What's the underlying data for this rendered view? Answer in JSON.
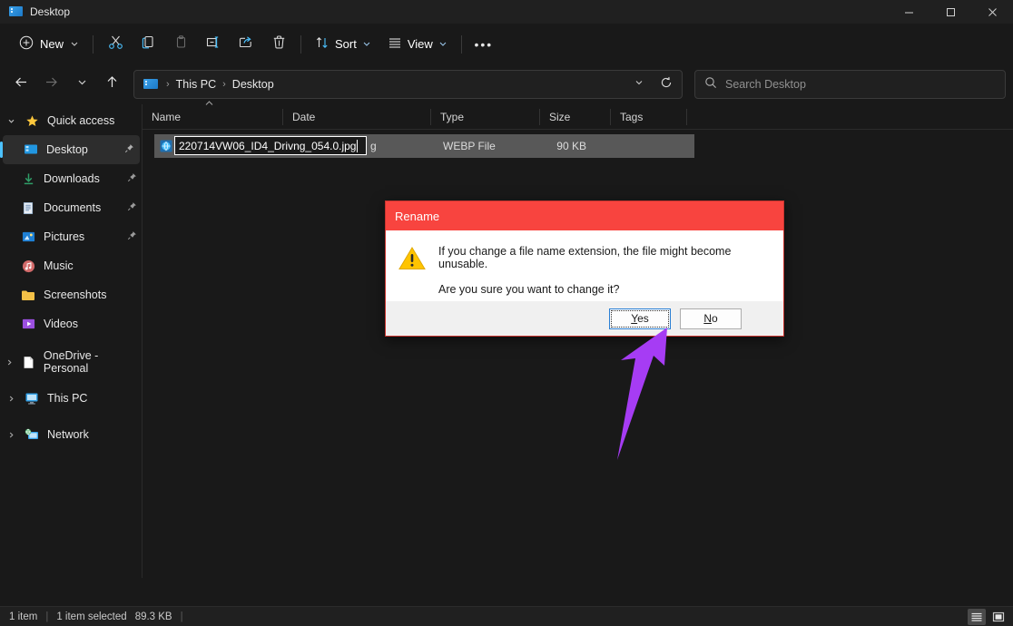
{
  "window": {
    "title": "Desktop",
    "icon": "desktop-folder-icon",
    "controls": {
      "minimize": "minimize-icon",
      "maximize": "maximize-icon",
      "close": "close-icon"
    }
  },
  "toolbar": {
    "new_label": "New",
    "new_icon": "plus-circle-icon",
    "cut_icon": "scissors-icon",
    "copy_icon": "copy-icon",
    "paste_icon": "paste-icon",
    "rename_icon": "rename-icon",
    "share_icon": "share-icon",
    "delete_icon": "trash-icon",
    "sort_label": "Sort",
    "sort_icon": "sort-arrows-icon",
    "view_label": "View",
    "view_icon": "list-lines-icon",
    "more_label": "•••"
  },
  "nav": {
    "back_icon": "arrow-left-icon",
    "forward_icon": "arrow-right-icon",
    "recent_icon": "chevron-down-icon",
    "up_icon": "arrow-up-icon",
    "breadcrumb": [
      "This PC",
      "Desktop"
    ],
    "breadcrumb_separator": "›",
    "dropdown_icon": "chevron-down-icon",
    "refresh_icon": "refresh-icon"
  },
  "search": {
    "placeholder": "Search Desktop",
    "value": "",
    "icon": "search-icon"
  },
  "sidebar": {
    "groups": [
      {
        "label": "Quick access",
        "icon": "star-icon",
        "expanded": true,
        "items": [
          {
            "label": "Desktop",
            "icon": "desktop-icon",
            "pinned": true,
            "selected": true
          },
          {
            "label": "Downloads",
            "icon": "download-icon",
            "pinned": true,
            "selected": false
          },
          {
            "label": "Documents",
            "icon": "document-icon",
            "pinned": true,
            "selected": false
          },
          {
            "label": "Pictures",
            "icon": "pictures-icon",
            "pinned": true,
            "selected": false
          },
          {
            "label": "Music",
            "icon": "music-icon",
            "pinned": false,
            "selected": false
          },
          {
            "label": "Screenshots",
            "icon": "folder-icon",
            "pinned": false,
            "selected": false
          },
          {
            "label": "Videos",
            "icon": "video-icon",
            "pinned": false,
            "selected": false
          }
        ]
      },
      {
        "label": "OneDrive - Personal",
        "icon": "onedrive-icon",
        "expanded": false,
        "items": []
      },
      {
        "label": "This PC",
        "icon": "pc-icon",
        "expanded": false,
        "items": []
      },
      {
        "label": "Network",
        "icon": "network-icon",
        "expanded": false,
        "items": []
      }
    ]
  },
  "filelist": {
    "columns": [
      "Name",
      "Date",
      "Type",
      "Size",
      "Tags"
    ],
    "sorted_by": "Name",
    "sort_direction": "ascending",
    "rows": [
      {
        "name_editing": true,
        "rename_value": "220714VW06_ID4_Drivng_054.0.jpg",
        "name_tail": "g",
        "type": "WEBP File",
        "size": "90 KB",
        "tags": "",
        "date": "",
        "selected": true,
        "icon": "image-file-icon"
      }
    ]
  },
  "dialog": {
    "title": "Rename",
    "icon": "warning-triangle-icon",
    "message_line1": "If you change a file name extension, the file might become unusable.",
    "message_line2": "Are you sure you want to change it?",
    "buttons": [
      {
        "label": "Yes",
        "accelerator": "Y",
        "focused": true
      },
      {
        "label": "No",
        "accelerator": "N",
        "focused": false
      }
    ],
    "title_color": "#f8443f"
  },
  "statusbar": {
    "item_count": "1 item",
    "selection": "1 item selected",
    "selection_size": "89.3 KB",
    "separator": "|",
    "views": [
      {
        "name": "details-view",
        "active": true
      },
      {
        "name": "large-icons-view",
        "active": false
      }
    ]
  },
  "annotation": {
    "arrow_color": "#a63cf4",
    "points_to": "Yes"
  }
}
